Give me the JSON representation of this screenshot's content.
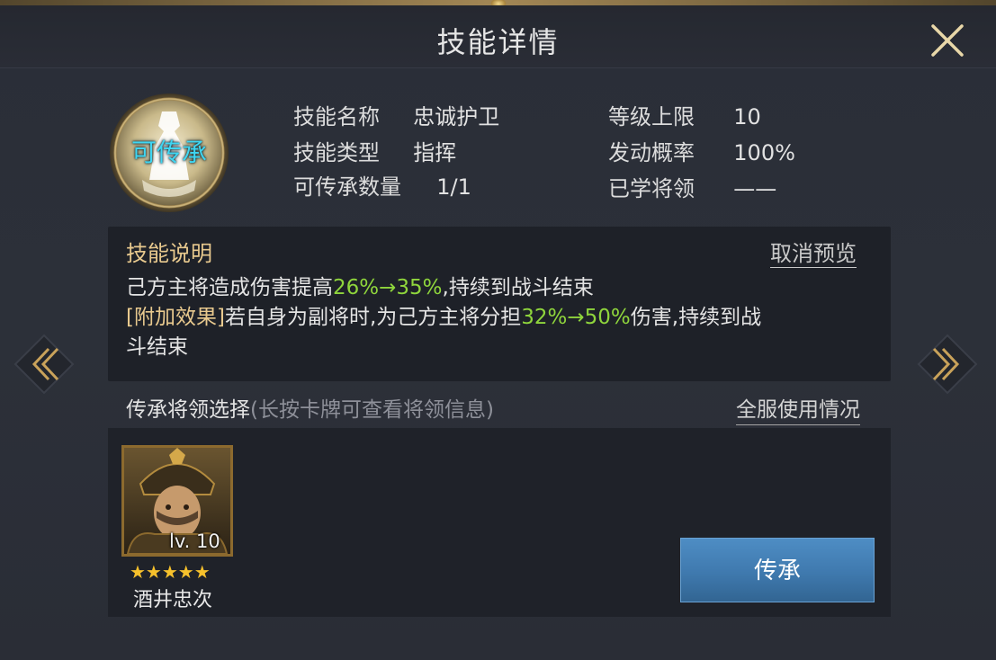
{
  "header": {
    "title": "技能详情"
  },
  "skill": {
    "badge": "可传承",
    "name_key": "技能名称",
    "name_value": "忠诚护卫",
    "type_key": "技能类型",
    "type_value": "指挥",
    "count_key": "可传承数量",
    "count_value": "1/1",
    "maxlv_key": "等级上限",
    "maxlv_value": "10",
    "rate_key": "发动概率",
    "rate_value": "100%",
    "learned_key": "已学将领",
    "learned_value": "——"
  },
  "description": {
    "title": "技能说明",
    "cancel_preview": "取消预览",
    "line1_a": "己方主将造成伤害提高",
    "line1_b": "26%→35%",
    "line1_c": ",持续到战斗结束",
    "line2_tag": "[附加效果]",
    "line2_a": "若自身为副将时,为己方主将分担",
    "line2_b": "32%→50%",
    "line2_c": "伤害,持续到战",
    "line3": "斗结束"
  },
  "inherit": {
    "title": "传承将领选择",
    "hint": "(长按卡牌可查看将领信息)",
    "usage_link": "全服使用情况",
    "general": {
      "level": "lv. 10",
      "stars": "★★★★★",
      "name": "酒井忠次"
    },
    "button": "传承"
  },
  "colors": {
    "highlight_green": "#8fd53c",
    "gold": "#e8c98e",
    "badge_cyan": "#3fd6f2",
    "button_blue": "#3f79ae"
  },
  "icons": {
    "close": "close-icon",
    "prev": "chevron-left-icon",
    "next": "chevron-right-icon"
  }
}
